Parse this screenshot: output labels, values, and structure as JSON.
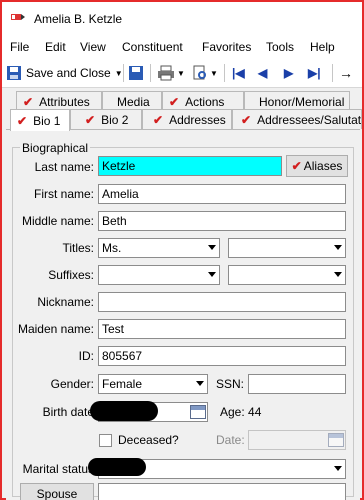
{
  "window": {
    "title": "Amelia B. Ketzle"
  },
  "menu": [
    "File",
    "Edit",
    "View",
    "Constituent",
    "Favorites",
    "Tools",
    "Help"
  ],
  "toolbar": {
    "save_close": "Save and Close"
  },
  "tabs_row1": [
    "Attributes",
    "Media",
    "Actions",
    "Honor/Memorial"
  ],
  "tabs_row2": [
    "Bio 1",
    "Bio 2",
    "Addresses",
    "Addressees/Salutatio"
  ],
  "biographical": {
    "group_title": "Biographical",
    "last_name_label": "Last name:",
    "last_name": "Ketzle",
    "aliases_button": "Aliases",
    "first_name_label": "First name:",
    "first_name": "Amelia",
    "middle_name_label": "Middle name:",
    "middle_name": "Beth",
    "titles_label": "Titles:",
    "title1": "Ms.",
    "suffixes_label": "Suffixes:",
    "nickname_label": "Nickname:",
    "nickname": "",
    "maiden_name_label": "Maiden name:",
    "maiden_name": "Test",
    "id_label": "ID:",
    "id": "805567",
    "gender_label": "Gender:",
    "gender": "Female",
    "ssn_label": "SSN:",
    "ssn": "",
    "birth_date_label": "Birth date",
    "age_text": "Age: 44",
    "deceased_label": "Deceased?",
    "date_label": "Date:",
    "marital_status_label": "Marital status",
    "spouse_button": "Spouse"
  }
}
